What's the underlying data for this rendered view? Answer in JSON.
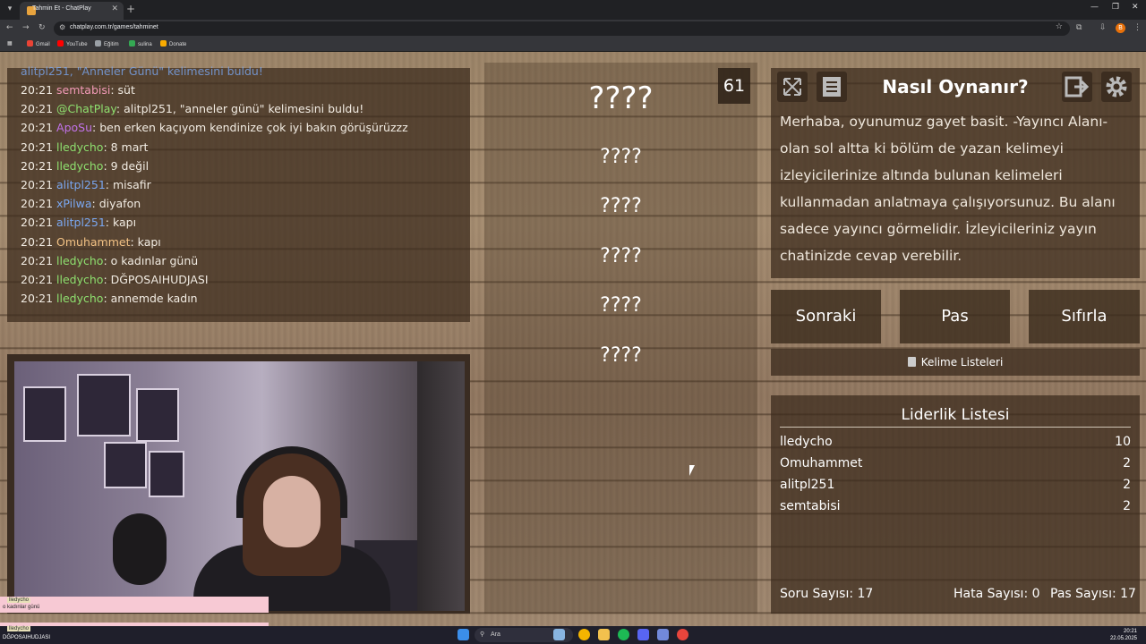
{
  "browser": {
    "tab_title": "Tahmin Et - ChatPlay",
    "url": "chatplay.com.tr/games/tahminet",
    "bookmarks": [
      {
        "label": "Gmail",
        "color": "#ea4335"
      },
      {
        "label": "YouTube",
        "color": "#ff0000"
      },
      {
        "label": "Eğitim",
        "color": "#9aa0a6"
      },
      {
        "label": "sulina",
        "color": "#34a853"
      },
      {
        "label": "Donate",
        "color": "#f9ab00"
      }
    ],
    "profile_initial": "B"
  },
  "chat": {
    "partial_top": "alitpl251, \"Anneler Günü\" kelimesini buldu!",
    "messages": [
      {
        "time": "20:21",
        "user": "semtabisi",
        "color": "#f29ab7",
        "text": ": süt"
      },
      {
        "time": "20:21",
        "user": "@ChatPlay",
        "color": "#8ee06f",
        "text": ": alitpl251, \"anneler günü\" kelimesini buldu!"
      },
      {
        "time": "20:21",
        "user": "ApoSu",
        "color": "#c172e8",
        "text": ": ben erken kaçıyom kendinize çok iyi bakın görüşürüzzz"
      },
      {
        "time": "20:21",
        "user": "lledycho",
        "color": "#8ee06f",
        "text": ": 8 mart"
      },
      {
        "time": "20:21",
        "user": "lledycho",
        "color": "#8ee06f",
        "text": ": 9 değil"
      },
      {
        "time": "20:21",
        "user": "alitpl251",
        "color": "#7aa7f0",
        "text": ": misafir"
      },
      {
        "time": "20:21",
        "user": "xPilwa",
        "color": "#7aa7f0",
        "text": ": diyafon"
      },
      {
        "time": "20:21",
        "user": "alitpl251",
        "color": "#7aa7f0",
        "text": ": kapı"
      },
      {
        "time": "20:21",
        "user": "Omuhammet",
        "color": "#f2c184",
        "text": ": kapı"
      },
      {
        "time": "20:21",
        "user": "lledycho",
        "color": "#8ee06f",
        "text": ": o kadınlar günü"
      },
      {
        "time": "20:21",
        "user": "lledycho",
        "color": "#8ee06f",
        "text": ": DĞPOSAIHUDJASI"
      },
      {
        "time": "20:21",
        "user": "lledycho",
        "color": "#8ee06f",
        "text": ": annemde kadın"
      }
    ]
  },
  "game": {
    "timer": "61",
    "main_word": "????",
    "forbidden_words": [
      "????",
      "????",
      "????",
      "????",
      "????"
    ]
  },
  "howto": {
    "title": "Nasıl Oynanır?",
    "text": "Merhaba, oyunumuz gayet basit. -Yayıncı Alanı- olan sol altta ki bölüm de yazan kelimeyi izleyicilerinize altında bulunan kelimeleri kullanmadan anlatmaya çalışıyorsunuz. Bu alanı sadece yayıncı görmelidir. İzleyicileriniz yayın chatinizde cevap verebilir.",
    "icons": [
      "fullscreen-icon",
      "notes-icon",
      "exit-icon",
      "settings-icon"
    ]
  },
  "controls": {
    "next": "Sonraki",
    "pass": "Pas",
    "reset": "Sıfırla",
    "word_lists": "Kelime Listeleri"
  },
  "leaderboard": {
    "title": "Liderlik Listesi",
    "rows": [
      {
        "name": "lledycho",
        "score": "10"
      },
      {
        "name": "Omuhammet",
        "score": "2"
      },
      {
        "name": "alitpl251",
        "score": "2"
      },
      {
        "name": "semtabisi",
        "score": "2"
      }
    ],
    "stats": {
      "questions": "Soru Sayısı: 17",
      "errors": "Hata Sayısı: 0",
      "passes": "Pas Sayısı: 17"
    }
  },
  "overlays": [
    {
      "name": "lledycho",
      "text": "o kadınlar günü"
    },
    {
      "name": "lledycho",
      "text": "DĞPOSAIHUDJASI"
    }
  ],
  "taskbar": {
    "search_placeholder": "Ara",
    "time": "20:21",
    "date": "22.05.2025"
  }
}
